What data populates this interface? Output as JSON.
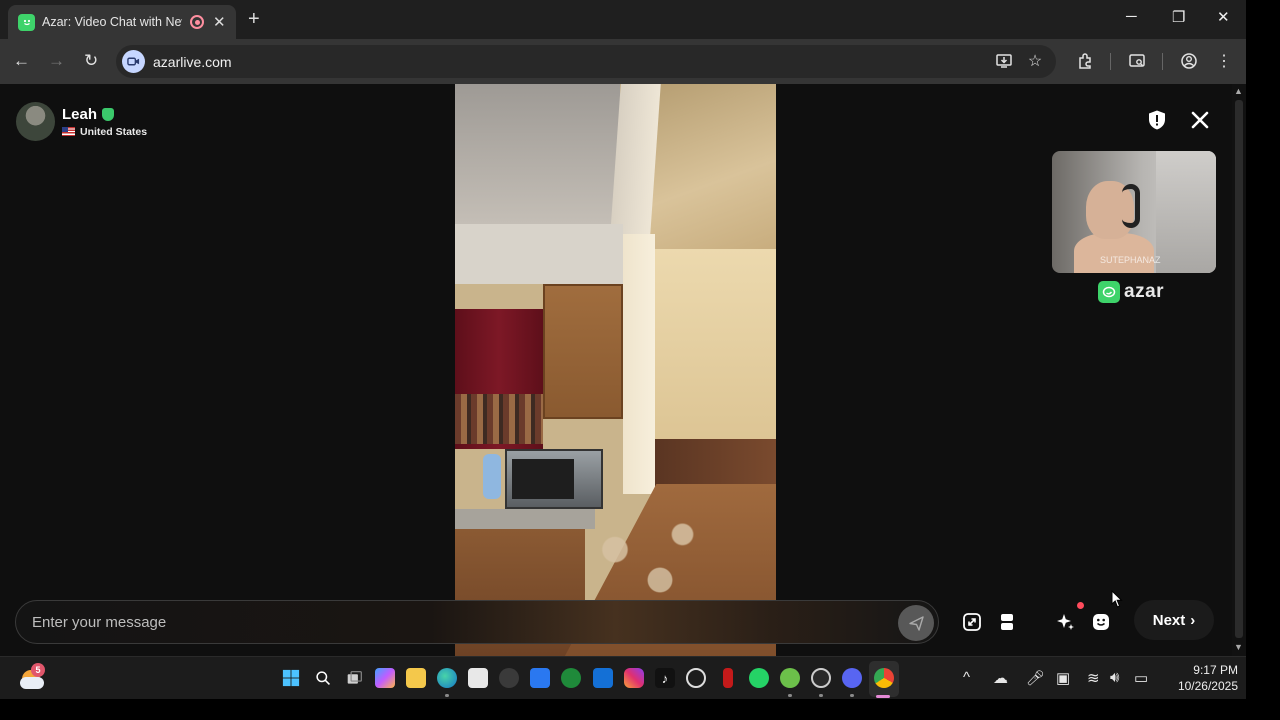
{
  "browser": {
    "tab_title": "Azar: Video Chat with New",
    "new_tab_glyph": "+",
    "url": "azarlive.com",
    "window_controls": [
      "minimize",
      "restore",
      "close"
    ],
    "toolbar_icons": [
      "install-app-icon",
      "bookmark-star-icon",
      "extensions-icon",
      "tab-search-icon",
      "profile-icon",
      "menu-icon"
    ]
  },
  "profile": {
    "name": "Leah",
    "country": "United States"
  },
  "selfview": {
    "watermark": "SUTEPHANAZ"
  },
  "brand": {
    "name": "azar",
    "accent": "#3ed36a"
  },
  "chat": {
    "placeholder": "Enter your message"
  },
  "controls": {
    "next_label": "Next",
    "items": [
      "fullscreen-icon",
      "layout-icon",
      "effects-icon",
      "emoji-icon"
    ]
  },
  "taskbar": {
    "weather_badge": "5",
    "apps": [
      "start",
      "search",
      "task-view",
      "copilot",
      "file-explorer",
      "edge",
      "store",
      "app",
      "app",
      "xbox",
      "outlook",
      "instagram",
      "tiktok",
      "chatgpt",
      "app",
      "whatsapp",
      "app",
      "app",
      "discord",
      "chrome"
    ],
    "time": "9:17 PM",
    "date": "10/26/2025"
  }
}
